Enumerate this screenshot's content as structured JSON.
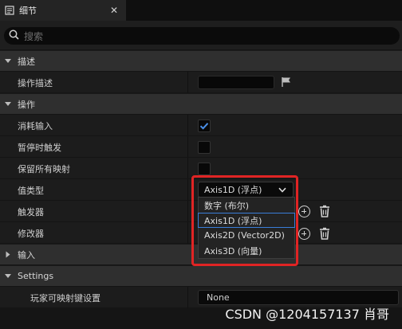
{
  "tab": {
    "title": "细节",
    "close": "✕"
  },
  "search": {
    "placeholder": "搜索"
  },
  "sections": {
    "describe": "描述",
    "operate": "操作",
    "input": "输入",
    "settings": "Settings"
  },
  "rows": {
    "op_desc": "操作描述",
    "consume_input": "消耗输入",
    "trigger_when_paused": "暂停时触发",
    "keep_all_mappings": "保留所有映射",
    "value_type": "值类型",
    "triggers": "触发器",
    "modifiers": "修改器",
    "player_mappable": "玩家可映射键设置"
  },
  "value_type_current": "Axis1D (浮点)",
  "value_type_options": [
    "数字 (布尔)",
    "Axis1D (浮点)",
    "Axis2D (Vector2D)",
    "Axis3D (向量)"
  ],
  "consume_input_checked": true,
  "player_mappable_value": "None",
  "watermark": "CSDN @1204157137 肖哥",
  "colors": {
    "accent": "#3a7ed8",
    "highlight_box": "#e02424",
    "check": "#4a8fe8"
  }
}
